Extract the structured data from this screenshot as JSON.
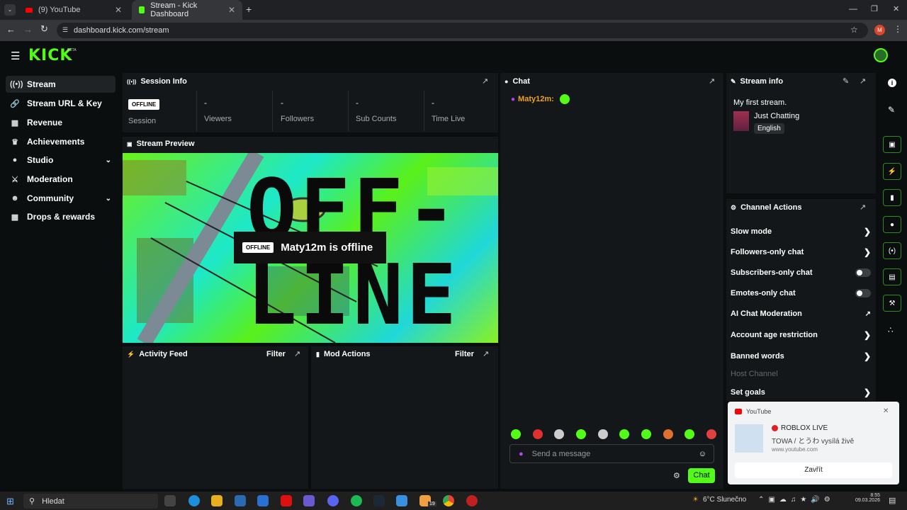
{
  "browser": {
    "tabs": [
      {
        "label": "(9) YouTube"
      },
      {
        "label": "Stream - Kick Dashboard"
      }
    ],
    "url": "dashboard.kick.com/stream",
    "profile_initial": "M"
  },
  "header": {
    "logo": "KICK",
    "beta": "BETA"
  },
  "sidebar": {
    "items": [
      {
        "label": "Stream",
        "icon": "broadcast-icon"
      },
      {
        "label": "Stream URL & Key",
        "icon": "link-icon"
      },
      {
        "label": "Revenue",
        "icon": "chart-icon"
      },
      {
        "label": "Achievements",
        "icon": "trophy-icon"
      },
      {
        "label": "Studio",
        "icon": "palette-icon"
      },
      {
        "label": "Moderation",
        "icon": "sword-icon"
      },
      {
        "label": "Community",
        "icon": "users-icon"
      },
      {
        "label": "Drops & rewards",
        "icon": "gift-icon"
      }
    ]
  },
  "session": {
    "title": "Session Info",
    "badge": "OFFLINE",
    "session_label": "Session",
    "stats": [
      {
        "value": "-",
        "label": "Viewers"
      },
      {
        "value": "-",
        "label": "Followers"
      },
      {
        "value": "-",
        "label": "Sub Counts"
      },
      {
        "value": "-",
        "label": "Time Live"
      }
    ]
  },
  "preview": {
    "title": "Stream Preview",
    "badge": "OFFLINE",
    "message": "Maty12m is offline",
    "bg_text": "OFF-LINE"
  },
  "activity": {
    "title": "Activity Feed",
    "filter": "Filter"
  },
  "mod": {
    "title": "Mod Actions",
    "filter": "Filter"
  },
  "chat": {
    "title": "Chat",
    "user": "Maty12m:",
    "placeholder": "Send a message",
    "send": "Chat"
  },
  "stream_info": {
    "title": "Stream info",
    "stream_title": "My first stream.",
    "category": "Just Chatting",
    "language": "English"
  },
  "channel_actions": {
    "title": "Channel Actions",
    "items": [
      {
        "label": "Slow mode"
      },
      {
        "label": "Followers-only chat"
      },
      {
        "label": "Subscribers-only chat"
      },
      {
        "label": "Emotes-only chat"
      },
      {
        "label": "AI Chat Moderation"
      },
      {
        "label": "Account age restriction"
      },
      {
        "label": "Banned words"
      },
      {
        "label": "Host Channel"
      },
      {
        "label": "Set goals"
      }
    ]
  },
  "notification": {
    "app": "YouTube",
    "title": "ROBLOX LIVE",
    "text": "TOWA / とうわ vysílá živě",
    "site": "www.youtube.com",
    "button": "Zavřít"
  },
  "taskbar": {
    "search": "Hledat",
    "weather": "6°C Slunečno",
    "time": "8:55",
    "date": "09.03.2026",
    "badge": "19"
  },
  "colors": {
    "accent": "#53fc18",
    "bg": "#0b0e0f",
    "panel": "#141719"
  }
}
